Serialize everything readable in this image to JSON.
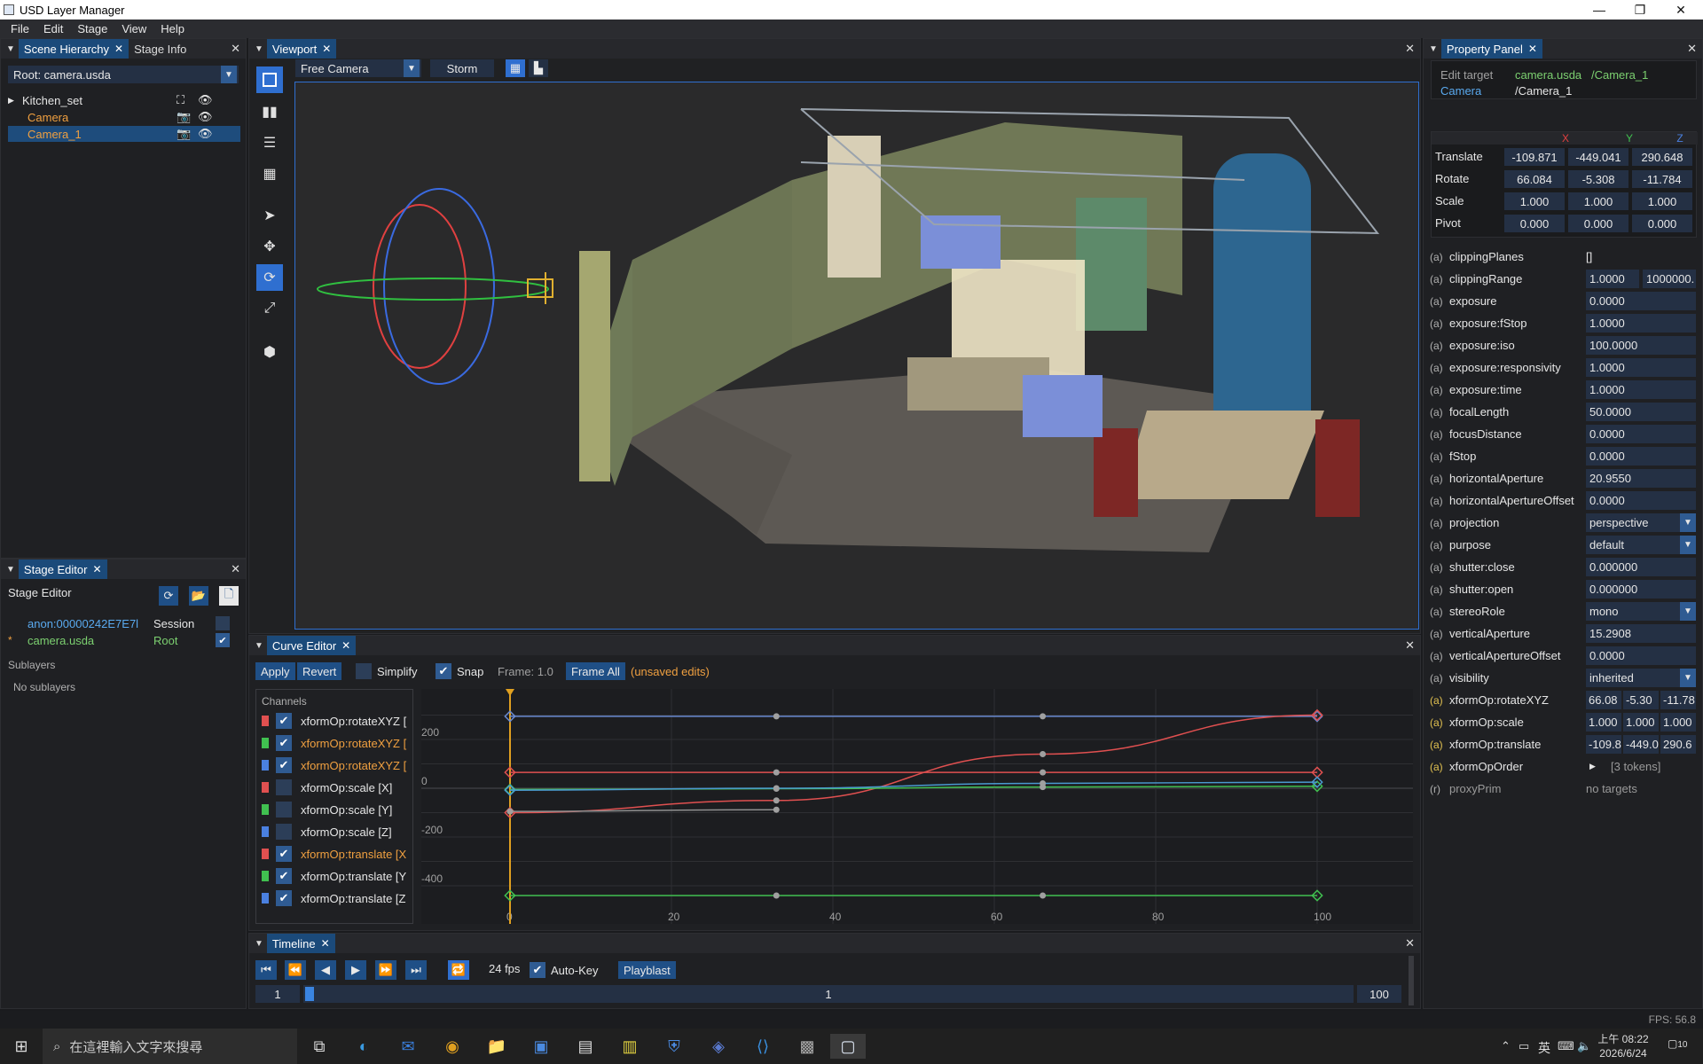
{
  "window": {
    "title": "USD Layer Manager"
  },
  "menu": [
    "File",
    "Edit",
    "Stage",
    "View",
    "Help"
  ],
  "hierarchy": {
    "tabs": [
      "Scene Hierarchy",
      "Stage Info"
    ],
    "root": "Root: camera.usda",
    "items": [
      "Kitchen_set",
      "Camera",
      "Camera_1"
    ]
  },
  "stage_editor": {
    "tab": "Stage Editor",
    "title": "Stage Editor",
    "layers": [
      {
        "name": "anon:00000242E7E7l",
        "role": "Session"
      },
      {
        "name": "camera.usda",
        "role": "Root",
        "marker": "*"
      }
    ],
    "sublayers_label": "Sublayers",
    "no_sublayers": "No sublayers"
  },
  "viewport": {
    "tab": "Viewport",
    "camera": "Free Camera",
    "renderer": "Storm"
  },
  "curve_editor": {
    "tab": "Curve Editor",
    "apply": "Apply",
    "revert": "Revert",
    "simplify": "Simplify",
    "snap": "Snap",
    "frame": "Frame: 1.0",
    "frame_all": "Frame All",
    "unsaved": "(unsaved edits)",
    "channels_label": "Channels",
    "channels": [
      {
        "name": "xformOp:rotateXYZ [",
        "color": "#e05050",
        "checked": true,
        "hl": false
      },
      {
        "name": "xformOp:rotateXYZ [",
        "color": "#40c050",
        "checked": true,
        "hl": true
      },
      {
        "name": "xformOp:rotateXYZ [",
        "color": "#4a80e0",
        "checked": true,
        "hl": true
      },
      {
        "name": "xformOp:scale [X]",
        "color": "#e05050",
        "checked": false,
        "hl": false
      },
      {
        "name": "xformOp:scale [Y]",
        "color": "#40c050",
        "checked": false,
        "hl": false
      },
      {
        "name": "xformOp:scale [Z]",
        "color": "#4a80e0",
        "checked": false,
        "hl": false
      },
      {
        "name": "xformOp:translate [X",
        "color": "#e05050",
        "checked": true,
        "hl": true
      },
      {
        "name": "xformOp:translate [Y",
        "color": "#40c050",
        "checked": true,
        "hl": false
      },
      {
        "name": "xformOp:translate [Z",
        "color": "#4a80e0",
        "checked": true,
        "hl": false
      }
    ],
    "y_ticks": [
      "200",
      "0",
      "-200",
      "-400"
    ],
    "x_ticks": [
      "0",
      "20",
      "40",
      "60",
      "80",
      "100"
    ]
  },
  "timeline": {
    "tab": "Timeline",
    "fps": "24 fps",
    "autokey": "Auto-Key",
    "playblast": "Playblast",
    "start": "1",
    "current": "1",
    "end": "100",
    "progress": 0.0
  },
  "property": {
    "tab": "Property Panel",
    "edit_target_label": "Edit target",
    "edit_target_file": "camera.usda",
    "edit_target_path": "/Camera_1",
    "prim_type": "Camera",
    "prim_path": "/Camera_1",
    "axes": [
      "X",
      "Y",
      "Z"
    ],
    "xform": [
      {
        "label": "Translate",
        "v": [
          "-109.871",
          "-449.041",
          "290.648"
        ]
      },
      {
        "label": "Rotate",
        "v": [
          "66.084",
          "-5.308",
          "-11.784"
        ]
      },
      {
        "label": "Scale",
        "v": [
          "1.000",
          "1.000",
          "1.000"
        ]
      },
      {
        "label": "Pivot",
        "v": [
          "0.000",
          "0.000",
          "0.000"
        ]
      }
    ],
    "attrs": [
      {
        "t": "(a)",
        "n": "clippingPlanes",
        "v": "[]",
        "plain": true
      },
      {
        "t": "(a)",
        "n": "clippingRange",
        "v": "1.0000",
        "v2": "1000000."
      },
      {
        "t": "(a)",
        "n": "exposure",
        "v": "0.0000"
      },
      {
        "t": "(a)",
        "n": "exposure:fStop",
        "v": "1.0000"
      },
      {
        "t": "(a)",
        "n": "exposure:iso",
        "v": "100.0000"
      },
      {
        "t": "(a)",
        "n": "exposure:responsivity",
        "v": "1.0000"
      },
      {
        "t": "(a)",
        "n": "exposure:time",
        "v": "1.0000"
      },
      {
        "t": "(a)",
        "n": "focalLength",
        "v": "50.0000"
      },
      {
        "t": "(a)",
        "n": "focusDistance",
        "v": "0.0000"
      },
      {
        "t": "(a)",
        "n": "fStop",
        "v": "0.0000"
      },
      {
        "t": "(a)",
        "n": "horizontalAperture",
        "v": "20.9550"
      },
      {
        "t": "(a)",
        "n": "horizontalApertureOffset",
        "v": "0.0000"
      },
      {
        "t": "(a)",
        "n": "projection",
        "v": "perspective",
        "dd": true
      },
      {
        "t": "(a)",
        "n": "purpose",
        "v": "default",
        "dd": true
      },
      {
        "t": "(a)",
        "n": "shutter:close",
        "v": "0.000000"
      },
      {
        "t": "(a)",
        "n": "shutter:open",
        "v": "0.000000"
      },
      {
        "t": "(a)",
        "n": "stereoRole",
        "v": "mono",
        "dd": true
      },
      {
        "t": "(a)",
        "n": "verticalAperture",
        "v": "15.2908"
      },
      {
        "t": "(a)",
        "n": "verticalApertureOffset",
        "v": "0.0000"
      },
      {
        "t": "(a)",
        "n": "visibility",
        "v": "inherited",
        "dd": true
      },
      {
        "t": "(a)",
        "n": "xformOp:rotateXYZ",
        "v3": [
          "66.08",
          "-5.30",
          "-11.78"
        ],
        "gold": true
      },
      {
        "t": "(a)",
        "n": "xformOp:scale",
        "v3": [
          "1.000",
          "1.000",
          "1.000"
        ],
        "gold": true
      },
      {
        "t": "(a)",
        "n": "xformOp:translate",
        "v3": [
          "-109.8",
          "-449.0",
          "290.6"
        ],
        "gold": true
      },
      {
        "t": "(a)",
        "n": "xformOpOrder",
        "v": "[3 tokens]",
        "arrow": true,
        "gold": true,
        "plain": true
      },
      {
        "t": "(r)",
        "n": "proxyPrim",
        "v": "no targets",
        "plain": true,
        "dim": true
      }
    ]
  },
  "status": {
    "fps": "FPS: 56.8"
  },
  "taskbar": {
    "search": "在這裡輸入文字來搜尋",
    "ime": "英",
    "time": "上午 08:22",
    "date": "2026/6/24",
    "notif": "10"
  }
}
